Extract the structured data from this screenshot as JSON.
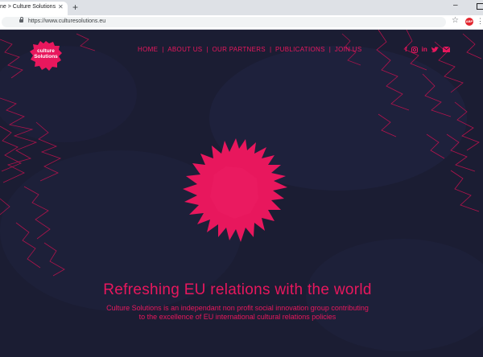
{
  "browser": {
    "tab_title": "ne > Culture Solutions",
    "new_tab_label": "+",
    "url": "https://www.culturesolutions.eu",
    "close_label": "✕",
    "ext_label": "ABP"
  },
  "site": {
    "logo_line1": "culture",
    "logo_line2": "Solutions",
    "nav": [
      "HOME",
      "ABOUT US",
      "OUR PARTNERS",
      "PUBLICATIONS",
      "JOIN US"
    ],
    "social_icons": [
      "facebook-icon",
      "instagram-icon",
      "linkedin-icon",
      "twitter-icon",
      "mail-icon"
    ],
    "headline": "Refreshing EU relations with the world",
    "subline_1": "Culture Solutions is an independant non profit social innovation group contributing",
    "subline_2": "to the excellence of EU international cultural relations policies"
  },
  "colors": {
    "accent": "#e8175d",
    "background": "#1b1d33"
  }
}
